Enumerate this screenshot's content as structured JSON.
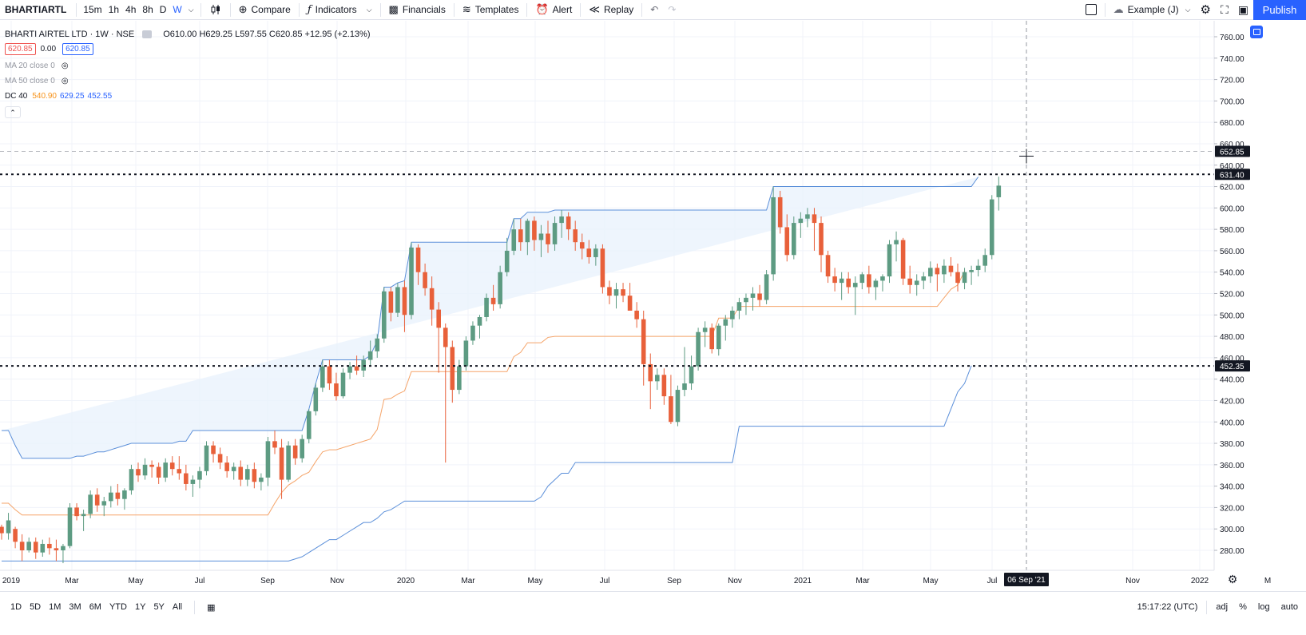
{
  "toolbar": {
    "symbol": "BHARTIARTL",
    "intervals": [
      "15m",
      "1h",
      "4h",
      "8h",
      "D",
      "W"
    ],
    "active_interval": "W",
    "compare": "Compare",
    "indicators": "Indicators",
    "financials": "Financials",
    "templates": "Templates",
    "alert": "Alert",
    "replay": "Replay",
    "layout_name": "Example (J)",
    "publish": "Publish"
  },
  "legend": {
    "title": "BHARTI AIRTEL LTD · 1W · NSE",
    "ohlc": "O610.00 H629.25 L597.55 C620.85 +12.95 (+2.13%)",
    "bid": "620.85",
    "spread": "0.00",
    "ask": "620.85",
    "ma20": "MA 20 close 0",
    "ma50": "MA 50 close 0",
    "dc_label": "DC 40",
    "dc_values": [
      "540.90",
      "629.25",
      "452.55"
    ]
  },
  "price_axis": {
    "ticks": [
      "760.00",
      "740.00",
      "720.00",
      "700.00",
      "680.00",
      "660.00",
      "640.00",
      "620.00",
      "600.00",
      "580.00",
      "560.00",
      "540.00",
      "520.00",
      "500.00",
      "480.00",
      "460.00",
      "440.00",
      "420.00",
      "400.00",
      "380.00",
      "360.00",
      "340.00",
      "320.00",
      "300.00",
      "280.00"
    ],
    "badges": [
      "652.85",
      "631.40",
      "452.35"
    ]
  },
  "time_axis": {
    "labels": [
      "2019",
      "Mar",
      "May",
      "Jul",
      "Sep",
      "Nov",
      "2020",
      "Mar",
      "May",
      "Jul",
      "Sep",
      "Nov",
      "2021",
      "Mar",
      "May",
      "Jul",
      "Nov",
      "2022",
      "M"
    ],
    "crosshair_label": "06 Sep '21"
  },
  "bottom": {
    "ranges": [
      "1D",
      "5D",
      "1M",
      "3M",
      "6M",
      "YTD",
      "1Y",
      "5Y",
      "All"
    ],
    "time": "15:17:22 (UTC)",
    "adj": "adj",
    "percent": "%",
    "log": "log",
    "auto": "auto"
  },
  "colors": {
    "up": "#5d9b82",
    "down": "#e8603a",
    "dc_upper_lower": "#5b8fd9",
    "dc_basis": "#f5a469",
    "dc_fill": "#eaf2fc",
    "accent": "#2962ff"
  },
  "chart_data": {
    "type": "candlestick",
    "title": "BHARTI AIRTEL LTD · 1W · NSE",
    "ylim": [
      270,
      775
    ],
    "horizontal_lines": [
      631.4,
      452.35
    ],
    "candles": [
      [
        302,
        304,
        290,
        296
      ],
      [
        296,
        315,
        290,
        308
      ],
      [
        300,
        302,
        282,
        288
      ],
      [
        288,
        295,
        270,
        280
      ],
      [
        280,
        292,
        278,
        288
      ],
      [
        288,
        292,
        272,
        278
      ],
      [
        278,
        290,
        274,
        286
      ],
      [
        286,
        292,
        276,
        282
      ],
      [
        282,
        290,
        270,
        280
      ],
      [
        280,
        286,
        268,
        284
      ],
      [
        284,
        324,
        282,
        320
      ],
      [
        320,
        324,
        308,
        312
      ],
      [
        312,
        318,
        298,
        314
      ],
      [
        314,
        336,
        310,
        332
      ],
      [
        332,
        338,
        316,
        322
      ],
      [
        322,
        330,
        312,
        326
      ],
      [
        326,
        340,
        320,
        334
      ],
      [
        334,
        342,
        322,
        328
      ],
      [
        328,
        338,
        318,
        336
      ],
      [
        336,
        360,
        332,
        356
      ],
      [
        356,
        362,
        344,
        350
      ],
      [
        350,
        366,
        346,
        360
      ],
      [
        360,
        364,
        348,
        358
      ],
      [
        358,
        362,
        342,
        348
      ],
      [
        348,
        366,
        344,
        362
      ],
      [
        362,
        368,
        350,
        356
      ],
      [
        356,
        368,
        346,
        352
      ],
      [
        352,
        360,
        336,
        342
      ],
      [
        342,
        350,
        330,
        346
      ],
      [
        346,
        358,
        338,
        354
      ],
      [
        354,
        382,
        350,
        378
      ],
      [
        378,
        382,
        362,
        370
      ],
      [
        370,
        376,
        356,
        362
      ],
      [
        362,
        368,
        348,
        354
      ],
      [
        354,
        362,
        346,
        358
      ],
      [
        358,
        364,
        340,
        346
      ],
      [
        346,
        360,
        340,
        356
      ],
      [
        356,
        362,
        338,
        344
      ],
      [
        344,
        352,
        336,
        348
      ],
      [
        348,
        386,
        340,
        382
      ],
      [
        382,
        392,
        370,
        376
      ],
      [
        376,
        384,
        328,
        346
      ],
      [
        346,
        382,
        344,
        378
      ],
      [
        378,
        384,
        360,
        366
      ],
      [
        366,
        388,
        362,
        384
      ],
      [
        384,
        412,
        380,
        410
      ],
      [
        410,
        436,
        406,
        432
      ],
      [
        432,
        458,
        428,
        452
      ],
      [
        452,
        458,
        430,
        436
      ],
      [
        436,
        446,
        420,
        424
      ],
      [
        424,
        450,
        422,
        446
      ],
      [
        446,
        456,
        440,
        452
      ],
      [
        452,
        462,
        444,
        448
      ],
      [
        448,
        462,
        442,
        458
      ],
      [
        458,
        476,
        452,
        466
      ],
      [
        466,
        482,
        460,
        478
      ],
      [
        478,
        526,
        474,
        522
      ],
      [
        522,
        526,
        494,
        502
      ],
      [
        502,
        530,
        498,
        526
      ],
      [
        526,
        532,
        484,
        500
      ],
      [
        500,
        568,
        496,
        563
      ],
      [
        563,
        566,
        528,
        540
      ],
      [
        540,
        548,
        518,
        525
      ],
      [
        525,
        536,
        490,
        505
      ],
      [
        505,
        512,
        446,
        488
      ],
      [
        488,
        492,
        362,
        470
      ],
      [
        470,
        476,
        418,
        430
      ],
      [
        430,
        458,
        426,
        452
      ],
      [
        452,
        480,
        448,
        476
      ],
      [
        476,
        494,
        472,
        490
      ],
      [
        490,
        500,
        478,
        498
      ],
      [
        498,
        520,
        494,
        516
      ],
      [
        516,
        528,
        504,
        510
      ],
      [
        510,
        546,
        506,
        540
      ],
      [
        540,
        572,
        536,
        560
      ],
      [
        560,
        590,
        556,
        580
      ],
      [
        580,
        590,
        560,
        568
      ],
      [
        568,
        590,
        556,
        588
      ],
      [
        588,
        592,
        560,
        570
      ],
      [
        570,
        584,
        554,
        576
      ],
      [
        576,
        588,
        558,
        566
      ],
      [
        566,
        592,
        560,
        586
      ],
      [
        586,
        598,
        572,
        592
      ],
      [
        592,
        596,
        570,
        580
      ],
      [
        580,
        588,
        560,
        568
      ],
      [
        568,
        576,
        552,
        562
      ],
      [
        562,
        570,
        548,
        554
      ],
      [
        554,
        566,
        546,
        562
      ],
      [
        562,
        566,
        520,
        526
      ],
      [
        526,
        532,
        510,
        518
      ],
      [
        518,
        530,
        506,
        524
      ],
      [
        524,
        530,
        512,
        518
      ],
      [
        518,
        530,
        506,
        504
      ],
      [
        504,
        512,
        488,
        496
      ],
      [
        496,
        504,
        434,
        454
      ],
      [
        454,
        464,
        412,
        438
      ],
      [
        438,
        450,
        430,
        444
      ],
      [
        444,
        450,
        416,
        424
      ],
      [
        424,
        444,
        398,
        400
      ],
      [
        400,
        434,
        396,
        430
      ],
      [
        430,
        470,
        424,
        436
      ],
      [
        436,
        462,
        430,
        452
      ],
      [
        452,
        488,
        448,
        484
      ],
      [
        484,
        494,
        470,
        488
      ],
      [
        488,
        492,
        464,
        468
      ],
      [
        468,
        492,
        462,
        490
      ],
      [
        490,
        500,
        476,
        496
      ],
      [
        496,
        508,
        488,
        504
      ],
      [
        504,
        516,
        496,
        512
      ],
      [
        512,
        520,
        500,
        516
      ],
      [
        516,
        526,
        504,
        520
      ],
      [
        520,
        528,
        508,
        514
      ],
      [
        514,
        542,
        510,
        538
      ],
      [
        538,
        620,
        532,
        610
      ],
      [
        610,
        616,
        576,
        582
      ],
      [
        582,
        594,
        550,
        556
      ],
      [
        556,
        592,
        552,
        586
      ],
      [
        586,
        596,
        572,
        590
      ],
      [
        590,
        600,
        582,
        594
      ],
      [
        594,
        600,
        560,
        586
      ],
      [
        586,
        592,
        540,
        556
      ],
      [
        556,
        560,
        530,
        536
      ],
      [
        536,
        544,
        522,
        530
      ],
      [
        530,
        540,
        514,
        534
      ],
      [
        534,
        540,
        520,
        526
      ],
      [
        526,
        536,
        500,
        530
      ],
      [
        530,
        540,
        524,
        538
      ],
      [
        538,
        546,
        520,
        526
      ],
      [
        526,
        534,
        514,
        532
      ],
      [
        532,
        538,
        522,
        536
      ],
      [
        536,
        570,
        530,
        566
      ],
      [
        566,
        578,
        550,
        570
      ],
      [
        570,
        572,
        528,
        534
      ],
      [
        534,
        546,
        520,
        528
      ],
      [
        528,
        538,
        518,
        532
      ],
      [
        532,
        540,
        524,
        536
      ],
      [
        536,
        550,
        530,
        544
      ],
      [
        544,
        548,
        522,
        538
      ],
      [
        538,
        552,
        530,
        546
      ],
      [
        546,
        554,
        536,
        540
      ],
      [
        540,
        548,
        522,
        530
      ],
      [
        530,
        544,
        524,
        540
      ],
      [
        540,
        546,
        528,
        542
      ],
      [
        542,
        552,
        536,
        546
      ],
      [
        546,
        562,
        540,
        556
      ],
      [
        556,
        612,
        552,
        608
      ],
      [
        610,
        629.25,
        597.55,
        620.85
      ]
    ],
    "donchian": {
      "upper": [
        392,
        392,
        378,
        366,
        366,
        366,
        366,
        366,
        366,
        366,
        366,
        368,
        368,
        370,
        372,
        372,
        374,
        376,
        378,
        380,
        380,
        380,
        380,
        380,
        380,
        380,
        382,
        382,
        392,
        392,
        392,
        392,
        392,
        392,
        392,
        392,
        392,
        392,
        392,
        392,
        392,
        392,
        392,
        392,
        392,
        412,
        436,
        458,
        458,
        458,
        458,
        458,
        458,
        458,
        462,
        476,
        526,
        526,
        530,
        532,
        568,
        568,
        568,
        568,
        568,
        568,
        568,
        568,
        568,
        568,
        568,
        568,
        568,
        568,
        568,
        590,
        590,
        596,
        596,
        596,
        596,
        598,
        598,
        598,
        598,
        598,
        598,
        598,
        598,
        598,
        598,
        598,
        598,
        598,
        598,
        598,
        598,
        598,
        598,
        598,
        598,
        598,
        598,
        598,
        598,
        598,
        598,
        598,
        598,
        598,
        598,
        598,
        598,
        620,
        620,
        620,
        620,
        620,
        620,
        620,
        620,
        620,
        620,
        620,
        620,
        620,
        620,
        620,
        620,
        620,
        620,
        620,
        620,
        620,
        620,
        620,
        620,
        620,
        620,
        620,
        620,
        620,
        620,
        629
      ],
      "lower": [
        270,
        270,
        270,
        270,
        270,
        270,
        270,
        270,
        270,
        270,
        270,
        270,
        270,
        270,
        270,
        270,
        270,
        270,
        270,
        270,
        270,
        270,
        270,
        270,
        270,
        270,
        270,
        270,
        270,
        270,
        270,
        270,
        270,
        270,
        270,
        270,
        270,
        270,
        270,
        270,
        270,
        270,
        270,
        272,
        274,
        278,
        282,
        286,
        290,
        290,
        294,
        298,
        302,
        306,
        306,
        310,
        316,
        318,
        322,
        326,
        326,
        326,
        326,
        326,
        326,
        326,
        326,
        326,
        326,
        326,
        326,
        326,
        326,
        326,
        326,
        326,
        326,
        326,
        326,
        330,
        340,
        346,
        352,
        352,
        362,
        362,
        362,
        362,
        362,
        362,
        362,
        362,
        362,
        362,
        362,
        362,
        362,
        362,
        362,
        362,
        362,
        362,
        362,
        362,
        362,
        362,
        362,
        362,
        396,
        396,
        396,
        396,
        396,
        396,
        396,
        396,
        396,
        396,
        396,
        396,
        396,
        396,
        396,
        396,
        396,
        396,
        396,
        396,
        396,
        396,
        396,
        396,
        396,
        396,
        396,
        396,
        396,
        396,
        396,
        412,
        428,
        436,
        452.55
      ],
      "basis": [
        324,
        324,
        318,
        313,
        313,
        313,
        313,
        313,
        313,
        313,
        313,
        313,
        313,
        313,
        313,
        313,
        313,
        313,
        313,
        313,
        313,
        313,
        313,
        313,
        313,
        313,
        313,
        313,
        313,
        313,
        313,
        313,
        313,
        313,
        313,
        313,
        313,
        313,
        313,
        313,
        324,
        334,
        341,
        345,
        350,
        353,
        363,
        372,
        374,
        374,
        376,
        378,
        380,
        382,
        384,
        393,
        421,
        422,
        426,
        429,
        447,
        447,
        447,
        447,
        447,
        447,
        447,
        447,
        447,
        447,
        447,
        447,
        447,
        447,
        447,
        461,
        465,
        474,
        474,
        474,
        479,
        480,
        480,
        480,
        480,
        480,
        480,
        480,
        480,
        480,
        480,
        480,
        480,
        480,
        480,
        480,
        480,
        480,
        480,
        480,
        480,
        480,
        480,
        480,
        480,
        497,
        497,
        497,
        508,
        508,
        508,
        508,
        508,
        508,
        508,
        508,
        508,
        508,
        508,
        508,
        508,
        508,
        508,
        508,
        508,
        508,
        508,
        508,
        508,
        508,
        508,
        508,
        508,
        508,
        508,
        508,
        508,
        508,
        516,
        524,
        528,
        540.9
      ]
    }
  }
}
